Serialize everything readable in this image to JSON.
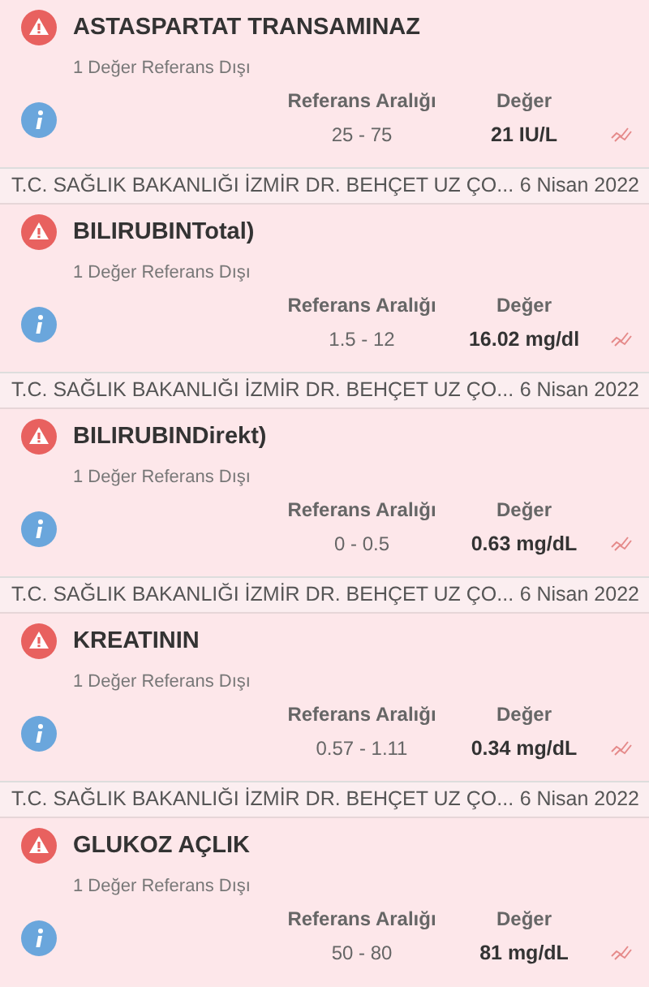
{
  "results": [
    {
      "title": "ASTASPARTAT TRANSAMINAZ",
      "subtitle": "1 Değer Referans Dışı",
      "range_label": "Referans Aralığı",
      "value_label": "Değer",
      "range": "25 - 75",
      "value": "21 IU/L"
    },
    {
      "source": "T.C. SAĞLIK BAKANLIĞI İZMİR DR. BEHÇET UZ ÇO...",
      "date": "6 Nisan 2022",
      "title": "BILIRUBINTotal)",
      "subtitle": "1 Değer Referans Dışı",
      "range_label": "Referans Aralığı",
      "value_label": "Değer",
      "range": "1.5 - 12",
      "value": "16.02 mg/dl"
    },
    {
      "source": "T.C. SAĞLIK BAKANLIĞI İZMİR DR. BEHÇET UZ ÇO...",
      "date": "6 Nisan 2022",
      "title": "BILIRUBINDirekt)",
      "subtitle": "1 Değer Referans Dışı",
      "range_label": "Referans Aralığı",
      "value_label": "Değer",
      "range": "0 - 0.5",
      "value": "0.63 mg/dL"
    },
    {
      "source": "T.C. SAĞLIK BAKANLIĞI İZMİR DR. BEHÇET UZ ÇO...",
      "date": "6 Nisan 2022",
      "title": "KREATININ",
      "subtitle": "1 Değer Referans Dışı",
      "range_label": "Referans Aralığı",
      "value_label": "Değer",
      "range": "0.57 - 1.11",
      "value": "0.34 mg/dL"
    },
    {
      "source": "T.C. SAĞLIK BAKANLIĞI İZMİR DR. BEHÇET UZ ÇO...",
      "date": "6 Nisan 2022",
      "title": "GLUKOZ AÇLIK",
      "subtitle": "1 Değer Referans Dışı",
      "range_label": "Referans Aralığı",
      "value_label": "Değer",
      "range": "50 - 80",
      "value": "81 mg/dL"
    }
  ]
}
